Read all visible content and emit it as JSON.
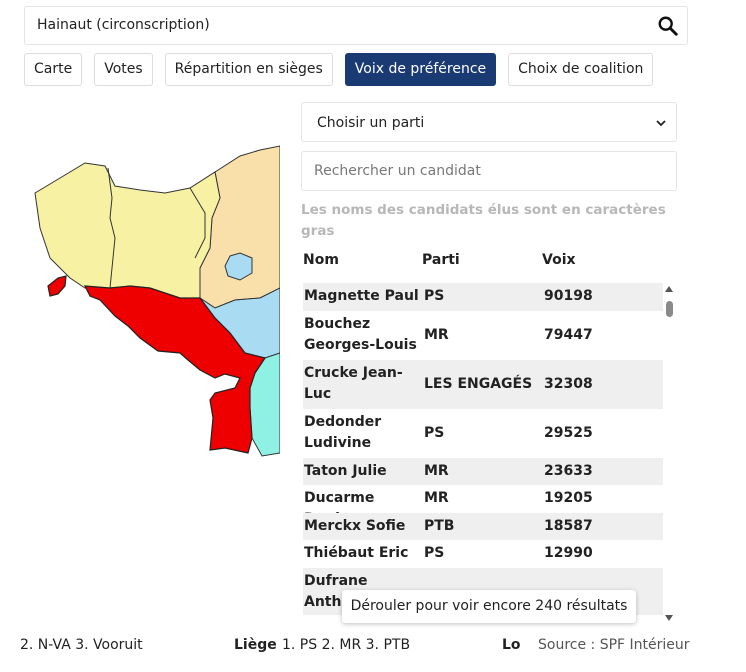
{
  "search": {
    "value": "Hainaut (circonscription)"
  },
  "tabs": [
    {
      "label": "Carte"
    },
    {
      "label": "Votes"
    },
    {
      "label": "Répartition en sièges"
    },
    {
      "label": "Voix de préférence",
      "active": true
    },
    {
      "label": "Choix de coalition"
    }
  ],
  "party_select": {
    "value": "Choisir un parti"
  },
  "candidate_search": {
    "placeholder": "Rechercher un candidat"
  },
  "note": "Les noms des candidats élus sont en caractères gras",
  "table": {
    "headers": {
      "name": "Nom",
      "party": "Parti",
      "votes": "Voix"
    },
    "rows": [
      {
        "name": "Magnette Paul",
        "party": "PS",
        "votes": "90198"
      },
      {
        "name": "Bouchez Georges-Louis",
        "party": "MR",
        "votes": "79447"
      },
      {
        "name": "Crucke Jean-Luc",
        "party": "LES ENGAGÉS",
        "votes": "32308"
      },
      {
        "name": "Dedonder Ludivine",
        "party": "PS",
        "votes": "29525"
      },
      {
        "name": "Taton Julie",
        "party": "MR",
        "votes": "23633"
      },
      {
        "name": "Ducarme Denis",
        "party": "MR",
        "votes": "19205"
      },
      {
        "name": "Merckx Sofie",
        "party": "PTB",
        "votes": "18587"
      },
      {
        "name": "Thiébaut Eric",
        "party": "PS",
        "votes": "12990"
      },
      {
        "name": "Dufrane Anthony",
        "party": "",
        "votes": ""
      }
    ]
  },
  "scroll_hint": "Dérouler pour voir encore 240 résultats",
  "footer": {
    "seg1": "2. N-VA  3. Vooruit",
    "liege_label": "Liège",
    "liege_results": "1. PS  2. MR  3. PTB",
    "next_label": "Lo",
    "source": "Source : SPF Intérieur"
  },
  "colors": {
    "active_tab": "#1a3a73",
    "selected_region": "#ee0000",
    "region_yellow": "#f7f1a4",
    "region_orange": "#f9dfa9",
    "region_blue": "#a9dcf3",
    "region_cyan": "#8ff0e4"
  },
  "icons": {
    "search": "magnifier-icon",
    "select": "chevron-down-icon"
  }
}
